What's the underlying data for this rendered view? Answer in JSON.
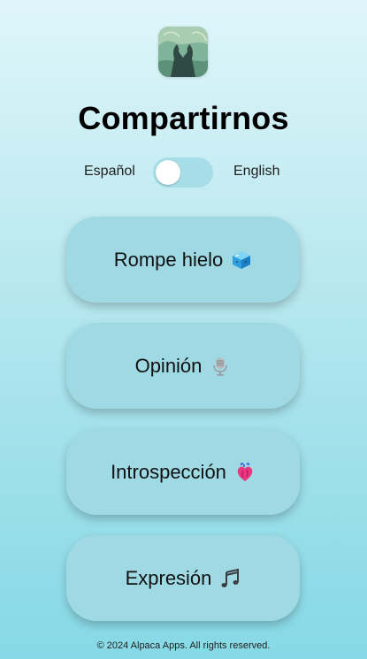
{
  "app": {
    "title": "Compartirnos",
    "logo_icon": "heart-hands-logo-icon"
  },
  "language_toggle": {
    "left_label": "Español",
    "right_label": "English",
    "selected": "Español"
  },
  "cards": [
    {
      "label": "Rompe hielo",
      "icon": "ice-cube-icon"
    },
    {
      "label": "Opinión",
      "icon": "microphone-icon"
    },
    {
      "label": "Introspección",
      "icon": "anatomical-heart-icon"
    },
    {
      "label": "Expresión",
      "icon": "music-notes-icon"
    }
  ],
  "footer": {
    "text": "© 2024 Alpaca Apps. All rights reserved."
  },
  "colors": {
    "background_top": "#dff6fa",
    "background_bottom": "#86d9e6",
    "card": "#9fd9e4",
    "toggle_track": "#a7dde6"
  }
}
